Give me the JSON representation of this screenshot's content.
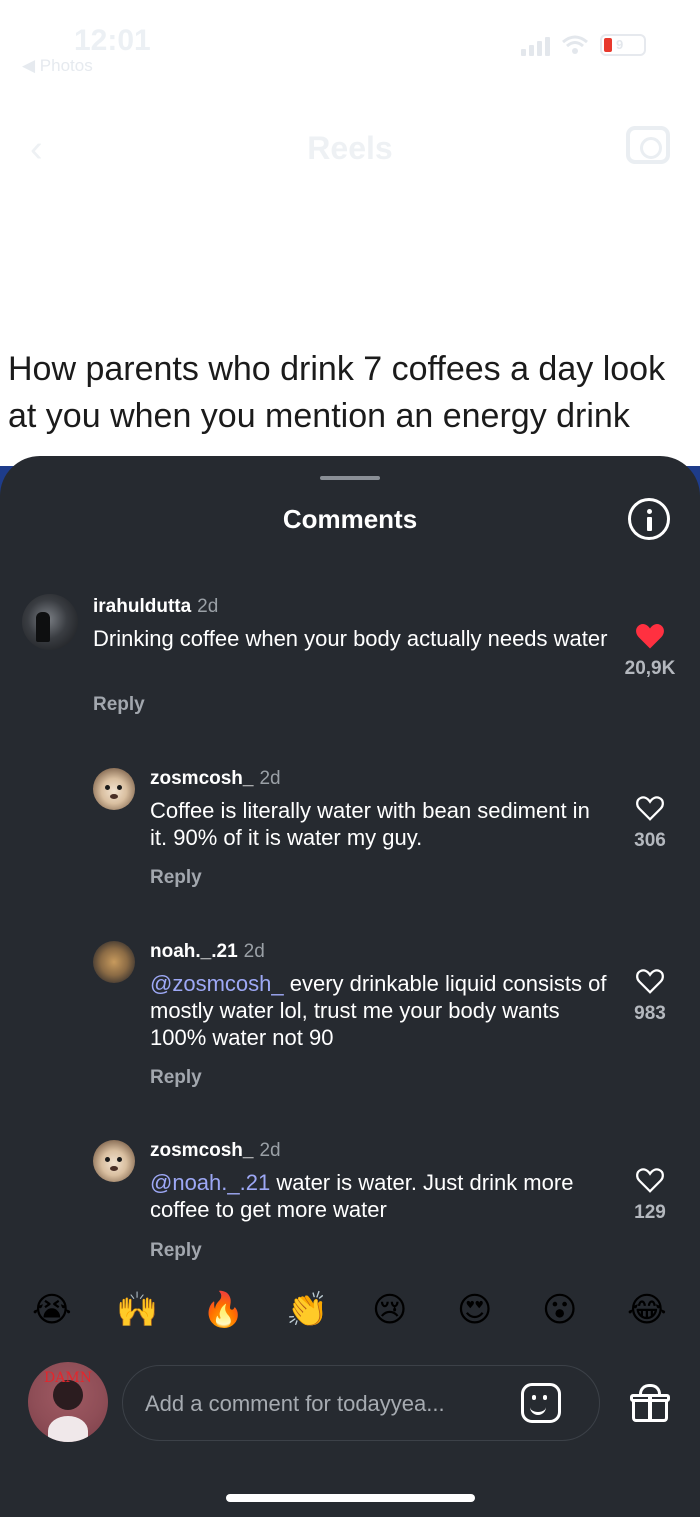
{
  "status_bar": {
    "time": "12:01",
    "back_label": "◀ Photos",
    "battery": "9"
  },
  "reel_header": {
    "title": "Reels"
  },
  "reel": {
    "caption": "How parents who drink 7 coffees a day look at you when you mention an energy drink"
  },
  "comments_sheet": {
    "title": "Comments",
    "reply_label": "Reply",
    "comments": [
      {
        "user": "irahuldutta",
        "time": "2d",
        "mention": "",
        "text": "Drinking coffee when your body actually needs water",
        "likes": "20,9K",
        "liked": true
      },
      {
        "user": "zosmcosh_",
        "time": "2d",
        "mention": "",
        "text": "Coffee is literally water with bean sediment in it. 90% of it is water my guy.",
        "likes": "306",
        "liked": false
      },
      {
        "user": "noah._.21",
        "time": "2d",
        "mention": "@zosmcosh_",
        "text": " every drinkable liquid consists of mostly water lol, trust me your body wants 100% water not 90",
        "likes": "983",
        "liked": false
      },
      {
        "user": "zosmcosh_",
        "time": "2d",
        "mention": "@noah._.21",
        "text": " water is water. Just drink more coffee to get more water",
        "likes": "129",
        "liked": false
      }
    ]
  },
  "emoji_bar": [
    "😭",
    "🙌",
    "🔥",
    "👏",
    "😢",
    "😍",
    "😮",
    "😂"
  ],
  "composer": {
    "avatar_tag": "DAMN",
    "placeholder": "Add a comment for todayyea..."
  },
  "colors": {
    "sheet_bg": "#262a30",
    "liked_heart": "#ff3040",
    "mention": "#9da8f5"
  }
}
